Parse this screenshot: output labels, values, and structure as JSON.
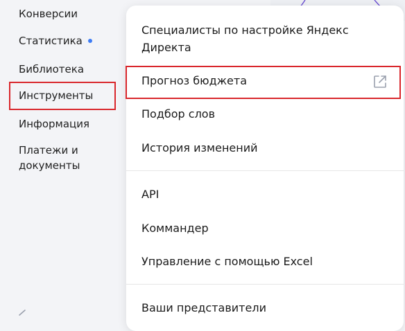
{
  "sidebar": {
    "items": [
      {
        "label": "Конверсии"
      },
      {
        "label": "Статистика",
        "has_dot": true
      },
      {
        "label": "Библиотека"
      },
      {
        "label": "Инструменты",
        "highlighted": true
      },
      {
        "label": "Информация"
      },
      {
        "label": "Платежи и\nдокументы"
      }
    ]
  },
  "menu": {
    "items": [
      {
        "label": "Специалисты по настройке Яндекс Директа"
      },
      {
        "label": "Прогноз бюджета",
        "highlighted": true,
        "icon": "external-link-icon"
      },
      {
        "label": "Подбор слов"
      },
      {
        "label": "История изменений"
      },
      {
        "label": "API"
      },
      {
        "label": "Коммандер"
      },
      {
        "label": "Управление с помощью Excel"
      },
      {
        "label": "Ваши представители"
      }
    ]
  },
  "colors": {
    "highlight": "#d9262b",
    "dot": "#3d7cf5",
    "decor_line": "#6b4fd3"
  }
}
